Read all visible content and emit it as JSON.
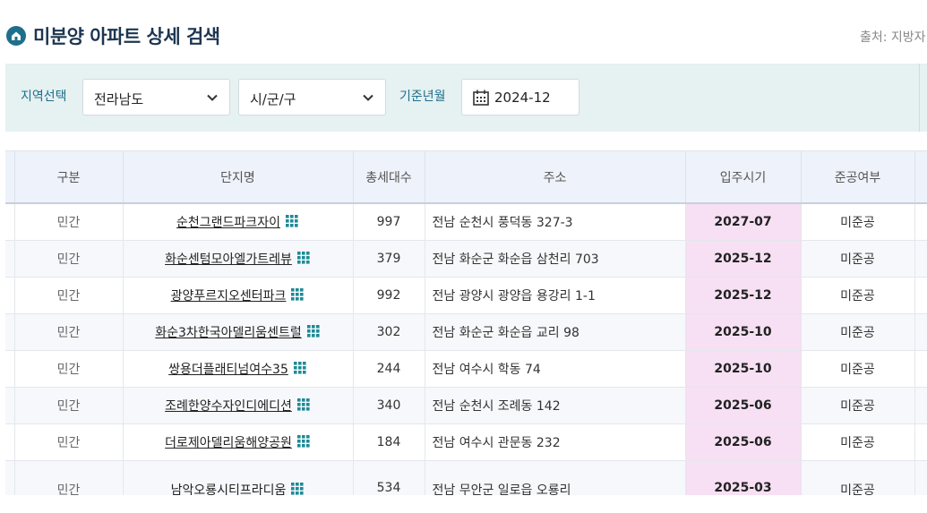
{
  "header": {
    "title": "미분양 아파트 상세 검색",
    "source": "출처: 지방자"
  },
  "filters": {
    "region_label": "지역선택",
    "province": "전라남도",
    "district": "시/군/구",
    "base_month_label": "기준년월",
    "base_month": "2024-12"
  },
  "table": {
    "columns": [
      "구분",
      "단지명",
      "총세대수",
      "주소",
      "입주시기",
      "준공여부"
    ],
    "rows": [
      {
        "type": "민간",
        "name": "순천그랜드파크자이",
        "units": "997",
        "address": "전남 순천시 풍덕동 327-3",
        "move_in": "2027-07",
        "status": "미준공"
      },
      {
        "type": "민간",
        "name": "화순센텀모아엘가트레뷰",
        "units": "379",
        "address": "전남 화순군 화순읍 삼천리 703",
        "move_in": "2025-12",
        "status": "미준공"
      },
      {
        "type": "민간",
        "name": "광양푸르지오센터파크",
        "units": "992",
        "address": "전남 광양시 광양읍 용강리 1-1",
        "move_in": "2025-12",
        "status": "미준공"
      },
      {
        "type": "민간",
        "name": "화순3차한국아델리움센트럴",
        "units": "302",
        "address": "전남 화순군 화순읍 교리 98",
        "move_in": "2025-10",
        "status": "미준공"
      },
      {
        "type": "민간",
        "name": "쌍용더플래티넘여수35",
        "units": "244",
        "address": "전남 여수시 학동 74",
        "move_in": "2025-10",
        "status": "미준공"
      },
      {
        "type": "민간",
        "name": "조례한양수자인디에디션",
        "units": "340",
        "address": "전남 순천시 조례동 142",
        "move_in": "2025-06",
        "status": "미준공"
      },
      {
        "type": "민간",
        "name": "더로제아델리움해양공원",
        "units": "184",
        "address": "전남 여수시 관문동 232",
        "move_in": "2025-06",
        "status": "미준공"
      },
      {
        "type": "민간",
        "name": "남악오룡시티프라디움",
        "units": "534",
        "address": "전남 무안군 일로읍 오룡리",
        "move_in": "2025-03",
        "status": "미준공"
      }
    ]
  },
  "colors": {
    "accent": "#1e6f8c",
    "filter_bg": "#e6f1f1",
    "move_in_highlight": "#f7e0f3",
    "header_bg": "#eef2fa"
  },
  "icons": {
    "logo": "house-pin-icon",
    "chevron": "chevron-down-icon",
    "calendar": "calendar-icon",
    "complex_detail": "grid-icon"
  }
}
